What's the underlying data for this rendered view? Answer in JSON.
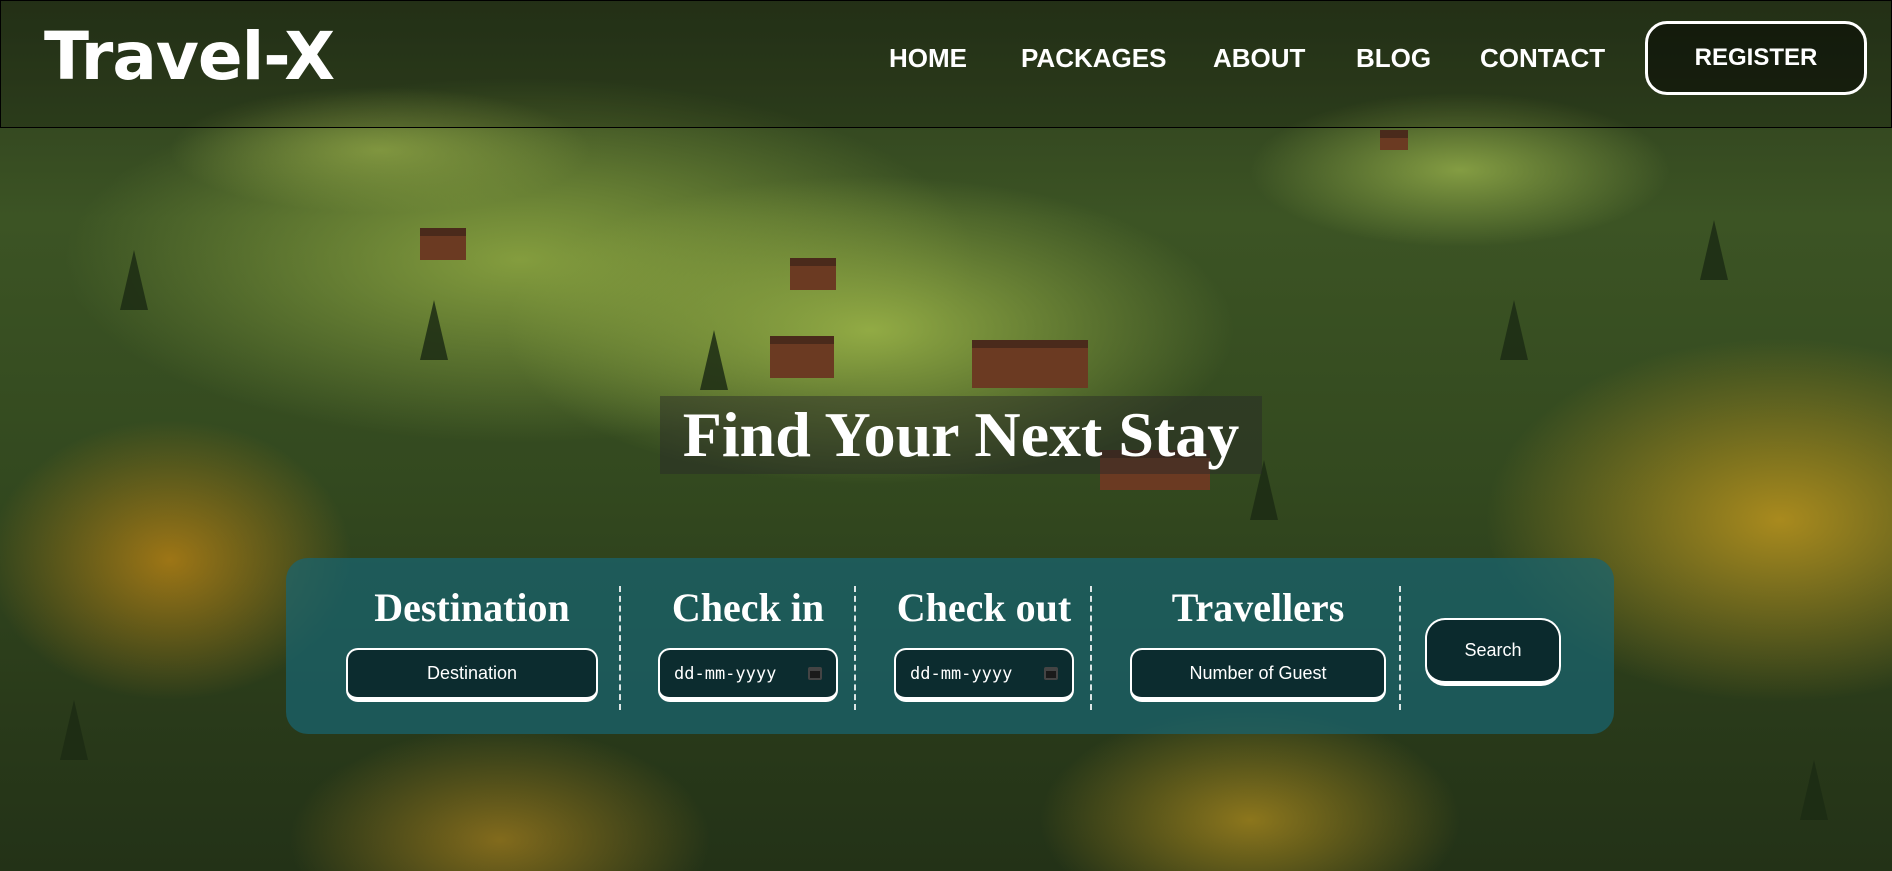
{
  "header": {
    "logo": "Travel-X",
    "nav": {
      "home": "HOME",
      "packages": "PACKAGES",
      "about": "ABOUT",
      "blog": "BLOG",
      "contact": "CONTACT"
    },
    "register_label": "REGISTER"
  },
  "hero": {
    "title": "Find Your Next Stay"
  },
  "search": {
    "destination": {
      "label": "Destination",
      "placeholder": "Destination"
    },
    "check_in": {
      "label": "Check in",
      "placeholder": "dd-mm-yyyy"
    },
    "check_out": {
      "label": "Check out",
      "placeholder": "dd-mm-yyyy"
    },
    "travellers": {
      "label": "Travellers",
      "placeholder": "Number of Guest"
    },
    "button_label": "Search"
  },
  "icons": {
    "check_in_calendar": "calendar-icon",
    "check_out_calendar": "calendar-icon"
  },
  "colors": {
    "panel": "#186470",
    "text": "#ffffff",
    "input_bg": "#082226"
  }
}
